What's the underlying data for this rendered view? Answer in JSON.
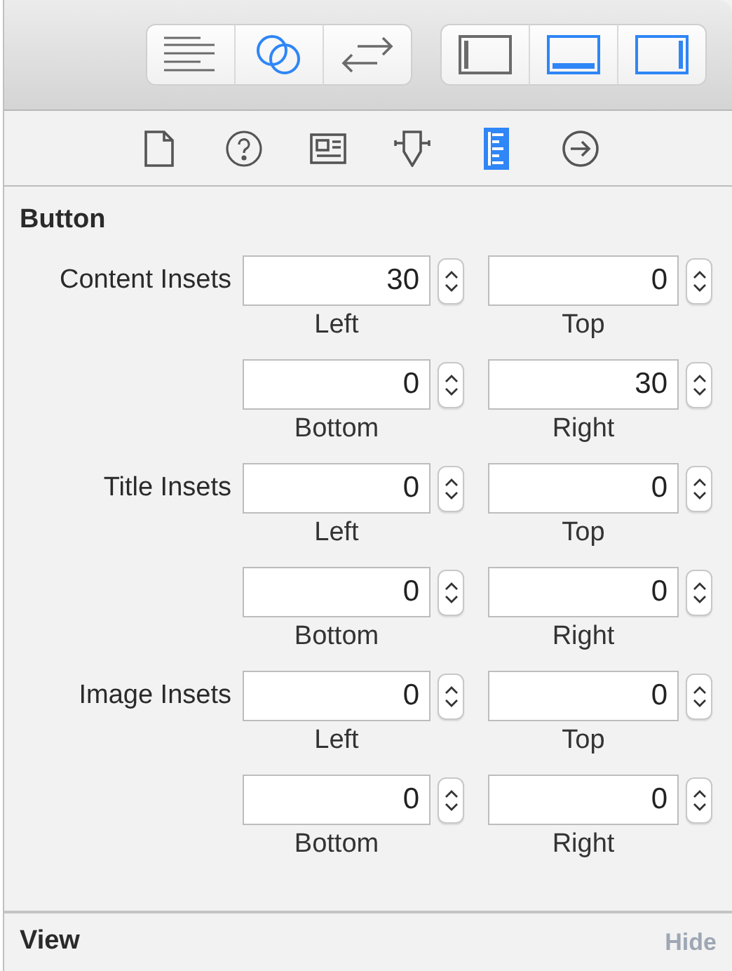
{
  "toolbar": {
    "groups": [
      [
        {
          "kind": "lines",
          "on": false
        },
        {
          "kind": "circles",
          "on": true
        },
        {
          "kind": "arrows",
          "on": false
        }
      ],
      [
        {
          "kind": "left-panel",
          "on": false
        },
        {
          "kind": "bottom-panel",
          "on": true
        },
        {
          "kind": "right-panel",
          "on": true
        }
      ]
    ]
  },
  "inspector_tabs": [
    {
      "kind": "file",
      "selected": false
    },
    {
      "kind": "help",
      "selected": false
    },
    {
      "kind": "identity",
      "selected": false
    },
    {
      "kind": "attributes",
      "selected": false
    },
    {
      "kind": "ruler",
      "selected": true
    },
    {
      "kind": "connections",
      "selected": false
    }
  ],
  "section": {
    "title": "Button",
    "groups": [
      {
        "label": "Content Insets",
        "fields": [
          {
            "value": "30",
            "caption": "Left"
          },
          {
            "value": "0",
            "caption": "Top"
          },
          {
            "value": "0",
            "caption": "Bottom"
          },
          {
            "value": "30",
            "caption": "Right"
          }
        ]
      },
      {
        "label": "Title Insets",
        "fields": [
          {
            "value": "0",
            "caption": "Left"
          },
          {
            "value": "0",
            "caption": "Top"
          },
          {
            "value": "0",
            "caption": "Bottom"
          },
          {
            "value": "0",
            "caption": "Right"
          }
        ]
      },
      {
        "label": "Image Insets",
        "fields": [
          {
            "value": "0",
            "caption": "Left"
          },
          {
            "value": "0",
            "caption": "Top"
          },
          {
            "value": "0",
            "caption": "Bottom"
          },
          {
            "value": "0",
            "caption": "Right"
          }
        ]
      }
    ]
  },
  "footer_section": {
    "title": "View",
    "action": "Hide"
  }
}
